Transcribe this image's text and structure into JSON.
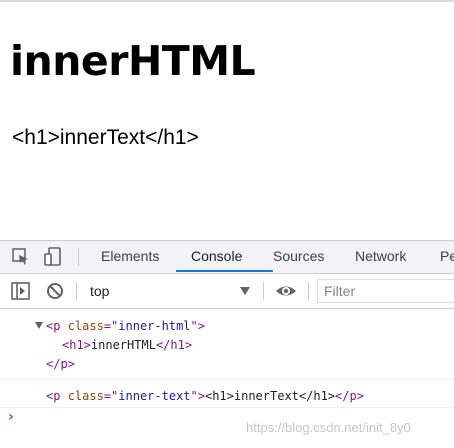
{
  "page": {
    "heading": "innerHTML",
    "paragraph_text": "<h1>innerText</h1>"
  },
  "devtools": {
    "tabs": [
      {
        "label": "Elements",
        "active": false
      },
      {
        "label": "Console",
        "active": true
      },
      {
        "label": "Sources",
        "active": false
      },
      {
        "label": "Network",
        "active": false
      },
      {
        "label": "Pe",
        "active": false
      }
    ],
    "icons": {
      "inspect": "inspect-element-icon",
      "device": "device-toolbar-icon",
      "sidebar": "show-sidebar-icon",
      "clear": "clear-console-icon",
      "eye": "live-expression-icon"
    },
    "context": "top",
    "filter_placeholder": "Filter",
    "console": {
      "entry1": {
        "open_tag": "<p",
        "attr_name": "class",
        "attr_eq": "=\"",
        "attr_value": "inner-html",
        "attr_close": "\">",
        "child_open": "<h1>",
        "child_text": "innerHTML",
        "child_close": "</h1>",
        "close_tag": "</p>"
      },
      "entry2": {
        "open_tag": "<p",
        "attr_name": "class",
        "attr_eq": "=\"",
        "attr_value": "inner-text",
        "attr_close": "\">",
        "text": "<h1>innerText</h1>",
        "close_tag": "</p>"
      },
      "prompt": "›"
    }
  },
  "watermark": "https://blog.csdn.net/init_8y0",
  "colors": {
    "accent": "#1a73e8",
    "tag": "#881280",
    "attr": "#994500",
    "value": "#1a1aa6"
  }
}
